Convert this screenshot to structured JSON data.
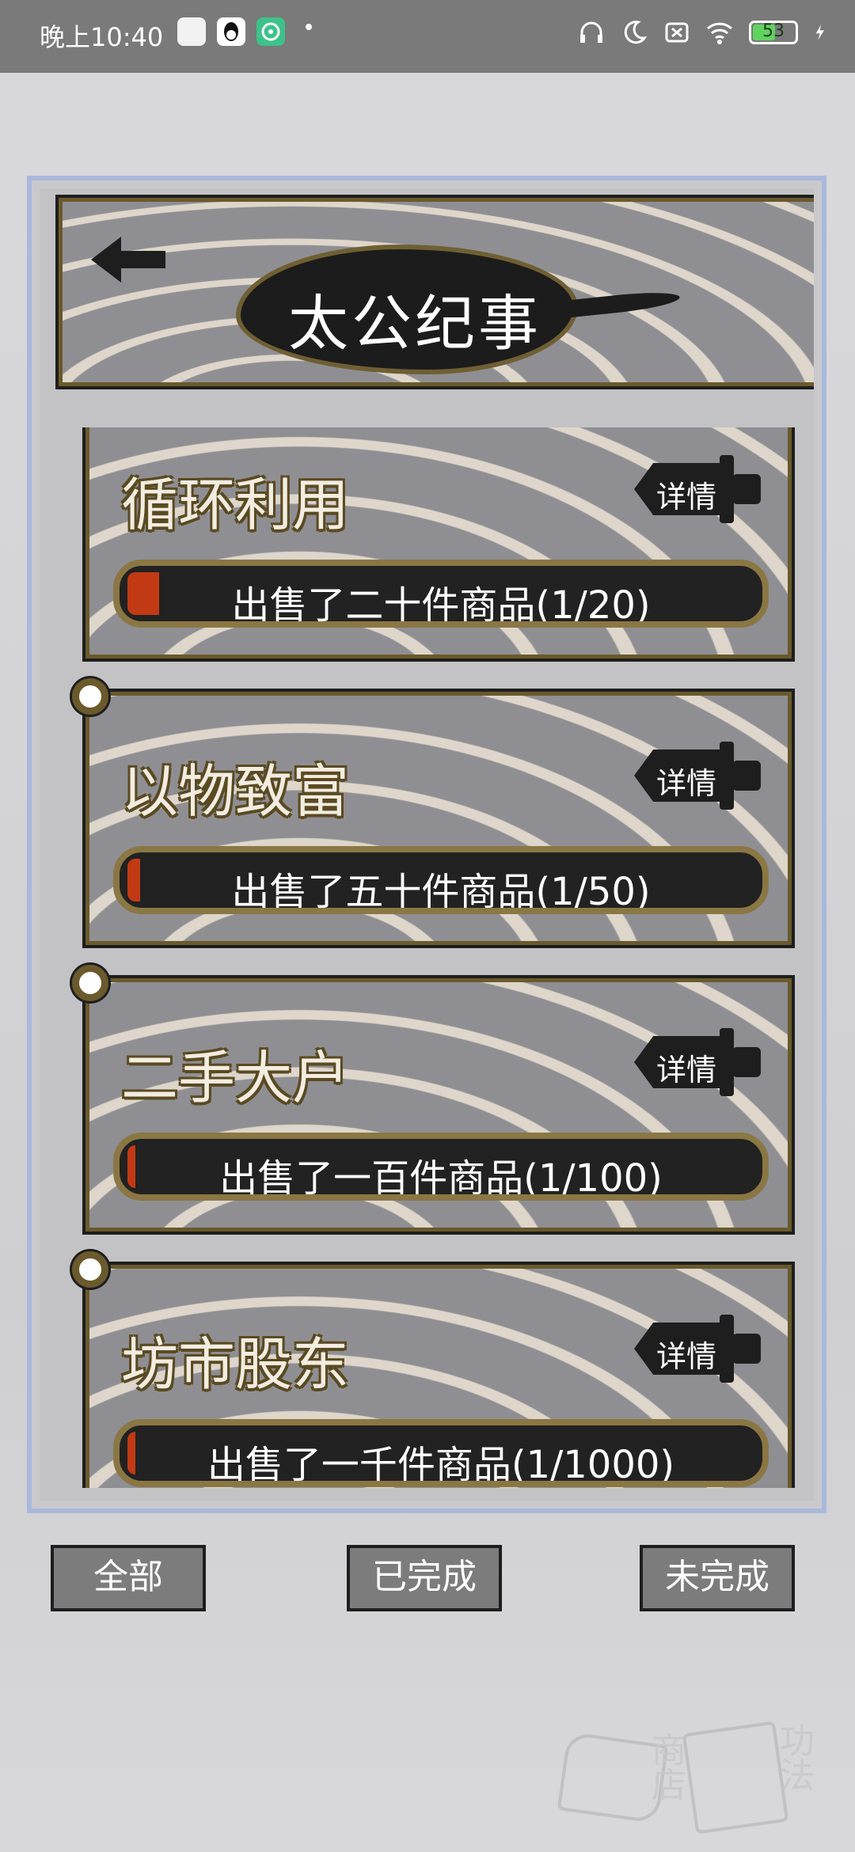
{
  "status_bar": {
    "time": "晚上10:40",
    "battery": "53",
    "battery_level": 0.53,
    "icons": [
      "news-app-icon",
      "qq-icon",
      "wifi-calling-app-icon",
      "headphones-icon",
      "moon-icon",
      "sim-off-icon",
      "wifi-icon",
      "battery-icon",
      "charging-icon"
    ]
  },
  "header": {
    "title": "太公纪事",
    "back_icon": "back-arrow-icon"
  },
  "achievements": [
    {
      "title": "循环利用",
      "detail_label": "详情",
      "progress_text": "出售了二十件商品(1/20)",
      "progress": 0.05
    },
    {
      "title": "以物致富",
      "detail_label": "详情",
      "progress_text": "出售了五十件商品(1/50)",
      "progress": 0.02
    },
    {
      "title": "二手大户",
      "detail_label": "详情",
      "progress_text": "出售了一百件商品(1/100)",
      "progress": 0.01
    },
    {
      "title": "坊市股东",
      "detail_label": "详情",
      "progress_text": "出售了一千件商品(1/1000)",
      "progress": 0.001
    }
  ],
  "tabs": {
    "all": "全部",
    "completed": "已完成",
    "incomplete": "未完成"
  },
  "faded_nav": {
    "shop": "商店",
    "skills": "功法"
  },
  "colors": {
    "frame": "#6a5a2c",
    "progress_fill": "#c23a14",
    "panel_border": "#a9b8dc"
  }
}
